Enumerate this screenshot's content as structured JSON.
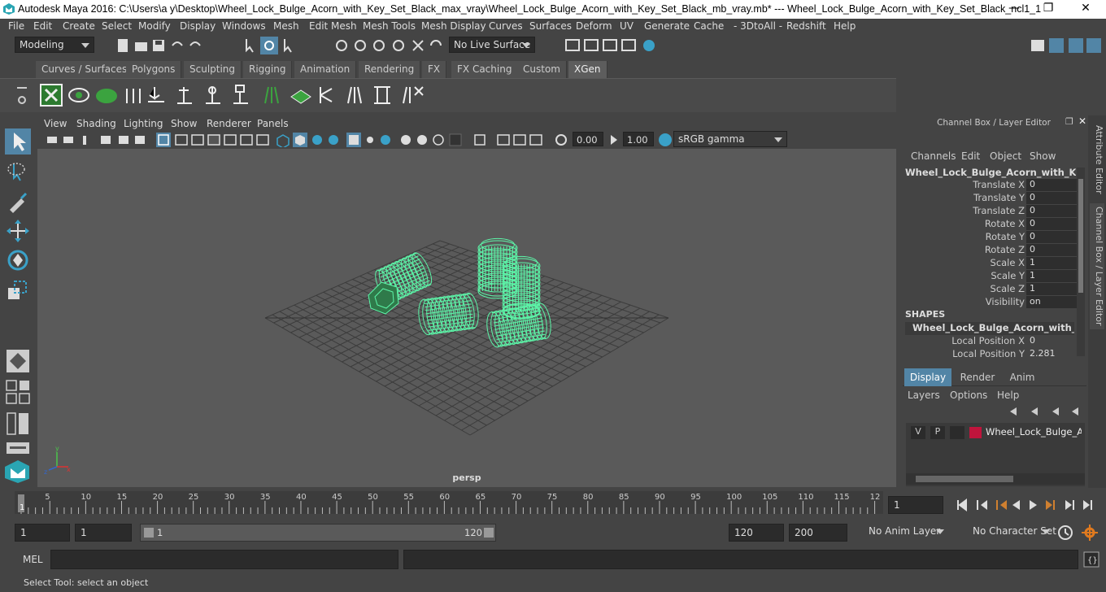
{
  "window": {
    "title": "Autodesk Maya 2016: C:\\Users\\a y\\Desktop\\Wheel_Lock_Bulge_Acorn_with_Key_Set_Black_max_vray\\Wheel_Lock_Bulge_Acorn_with_Key_Set_Black_mb_vray.mb*   ---   Wheel_Lock_Bulge_Acorn_with_Key_Set_Black_ncl1_1",
    "minimize": "—",
    "maximize": "❐",
    "close": "✕"
  },
  "menubar": [
    "File",
    "Edit",
    "Create",
    "Select",
    "Modify",
    "Display",
    "Windows",
    "Mesh",
    "Edit Mesh",
    "Mesh Tools",
    "Mesh Display",
    "Curves",
    "Surfaces",
    "Deform",
    "UV",
    "Generate",
    "Cache",
    "- 3DtoAll -",
    "Redshift",
    "Help"
  ],
  "status_line": {
    "mode": "Modeling",
    "live_surface": "No Live Surface"
  },
  "shelf_tabs": [
    "Curves / Surfaces",
    "Polygons",
    "Sculpting",
    "Rigging",
    "Animation",
    "Rendering",
    "FX",
    "FX Caching",
    "Custom",
    "XGen"
  ],
  "shelf_active": "XGen",
  "viewport_menu": [
    "View",
    "Shading",
    "Lighting",
    "Show",
    "Renderer",
    "Panels"
  ],
  "viewport_toolbar": {
    "exposure": "0.00",
    "gamma": "1.00",
    "color_space": "sRGB gamma"
  },
  "camera_label": "persp",
  "channel_box": {
    "panel_title": "Channel Box / Layer Editor",
    "menu": [
      "Channels",
      "Edit",
      "Object",
      "Show"
    ],
    "object_name": "Wheel_Lock_Bulge_Acorn_with_Key_S...",
    "channels": [
      {
        "label": "Translate X",
        "value": "0"
      },
      {
        "label": "Translate Y",
        "value": "0"
      },
      {
        "label": "Translate Z",
        "value": "0"
      },
      {
        "label": "Rotate X",
        "value": "0"
      },
      {
        "label": "Rotate Y",
        "value": "0"
      },
      {
        "label": "Rotate Z",
        "value": "0"
      },
      {
        "label": "Scale X",
        "value": "1"
      },
      {
        "label": "Scale Y",
        "value": "1"
      },
      {
        "label": "Scale Z",
        "value": "1"
      },
      {
        "label": "Visibility",
        "value": "on"
      }
    ],
    "shapes_header": "SHAPES",
    "shape_name": "Wheel_Lock_Bulge_Acorn_with_Key...",
    "shape_channels": [
      {
        "label": "Local Position X",
        "value": "0"
      },
      {
        "label": "Local Position Y",
        "value": "2.281"
      }
    ]
  },
  "layer_editor": {
    "tabs": [
      "Display",
      "Render",
      "Anim"
    ],
    "active_tab": "Display",
    "menu": [
      "Layers",
      "Options",
      "Help"
    ],
    "layer": {
      "v": "V",
      "p": "P",
      "name": "Wheel_Lock_Bulge_Acorn",
      "color": "#c0143c"
    }
  },
  "side_tabs": [
    "Attribute Editor",
    "Channel Box / Layer Editor"
  ],
  "timeline": {
    "ticks": [
      "5",
      "10",
      "15",
      "20",
      "25",
      "30",
      "35",
      "40",
      "45",
      "50",
      "55",
      "60",
      "65",
      "70",
      "75",
      "80",
      "85",
      "90",
      "95",
      "100",
      "105",
      "110",
      "115",
      "12"
    ],
    "current_frame_marker": "1",
    "current_frame": "1"
  },
  "range": {
    "start": "1",
    "playback_start": "1",
    "slider_start": "1",
    "slider_end": "120",
    "playback_end": "120",
    "end": "200",
    "anim_layer": "No Anim Layer",
    "character_set": "No Character Set"
  },
  "command_line": {
    "label": "MEL"
  },
  "help_line": "Select Tool: select an object",
  "colors": {
    "wireframe": "#5cf5a8",
    "grid": "#3b3b3b",
    "viewport_bg": "#5a5a5a",
    "accent": "#5285a6"
  }
}
